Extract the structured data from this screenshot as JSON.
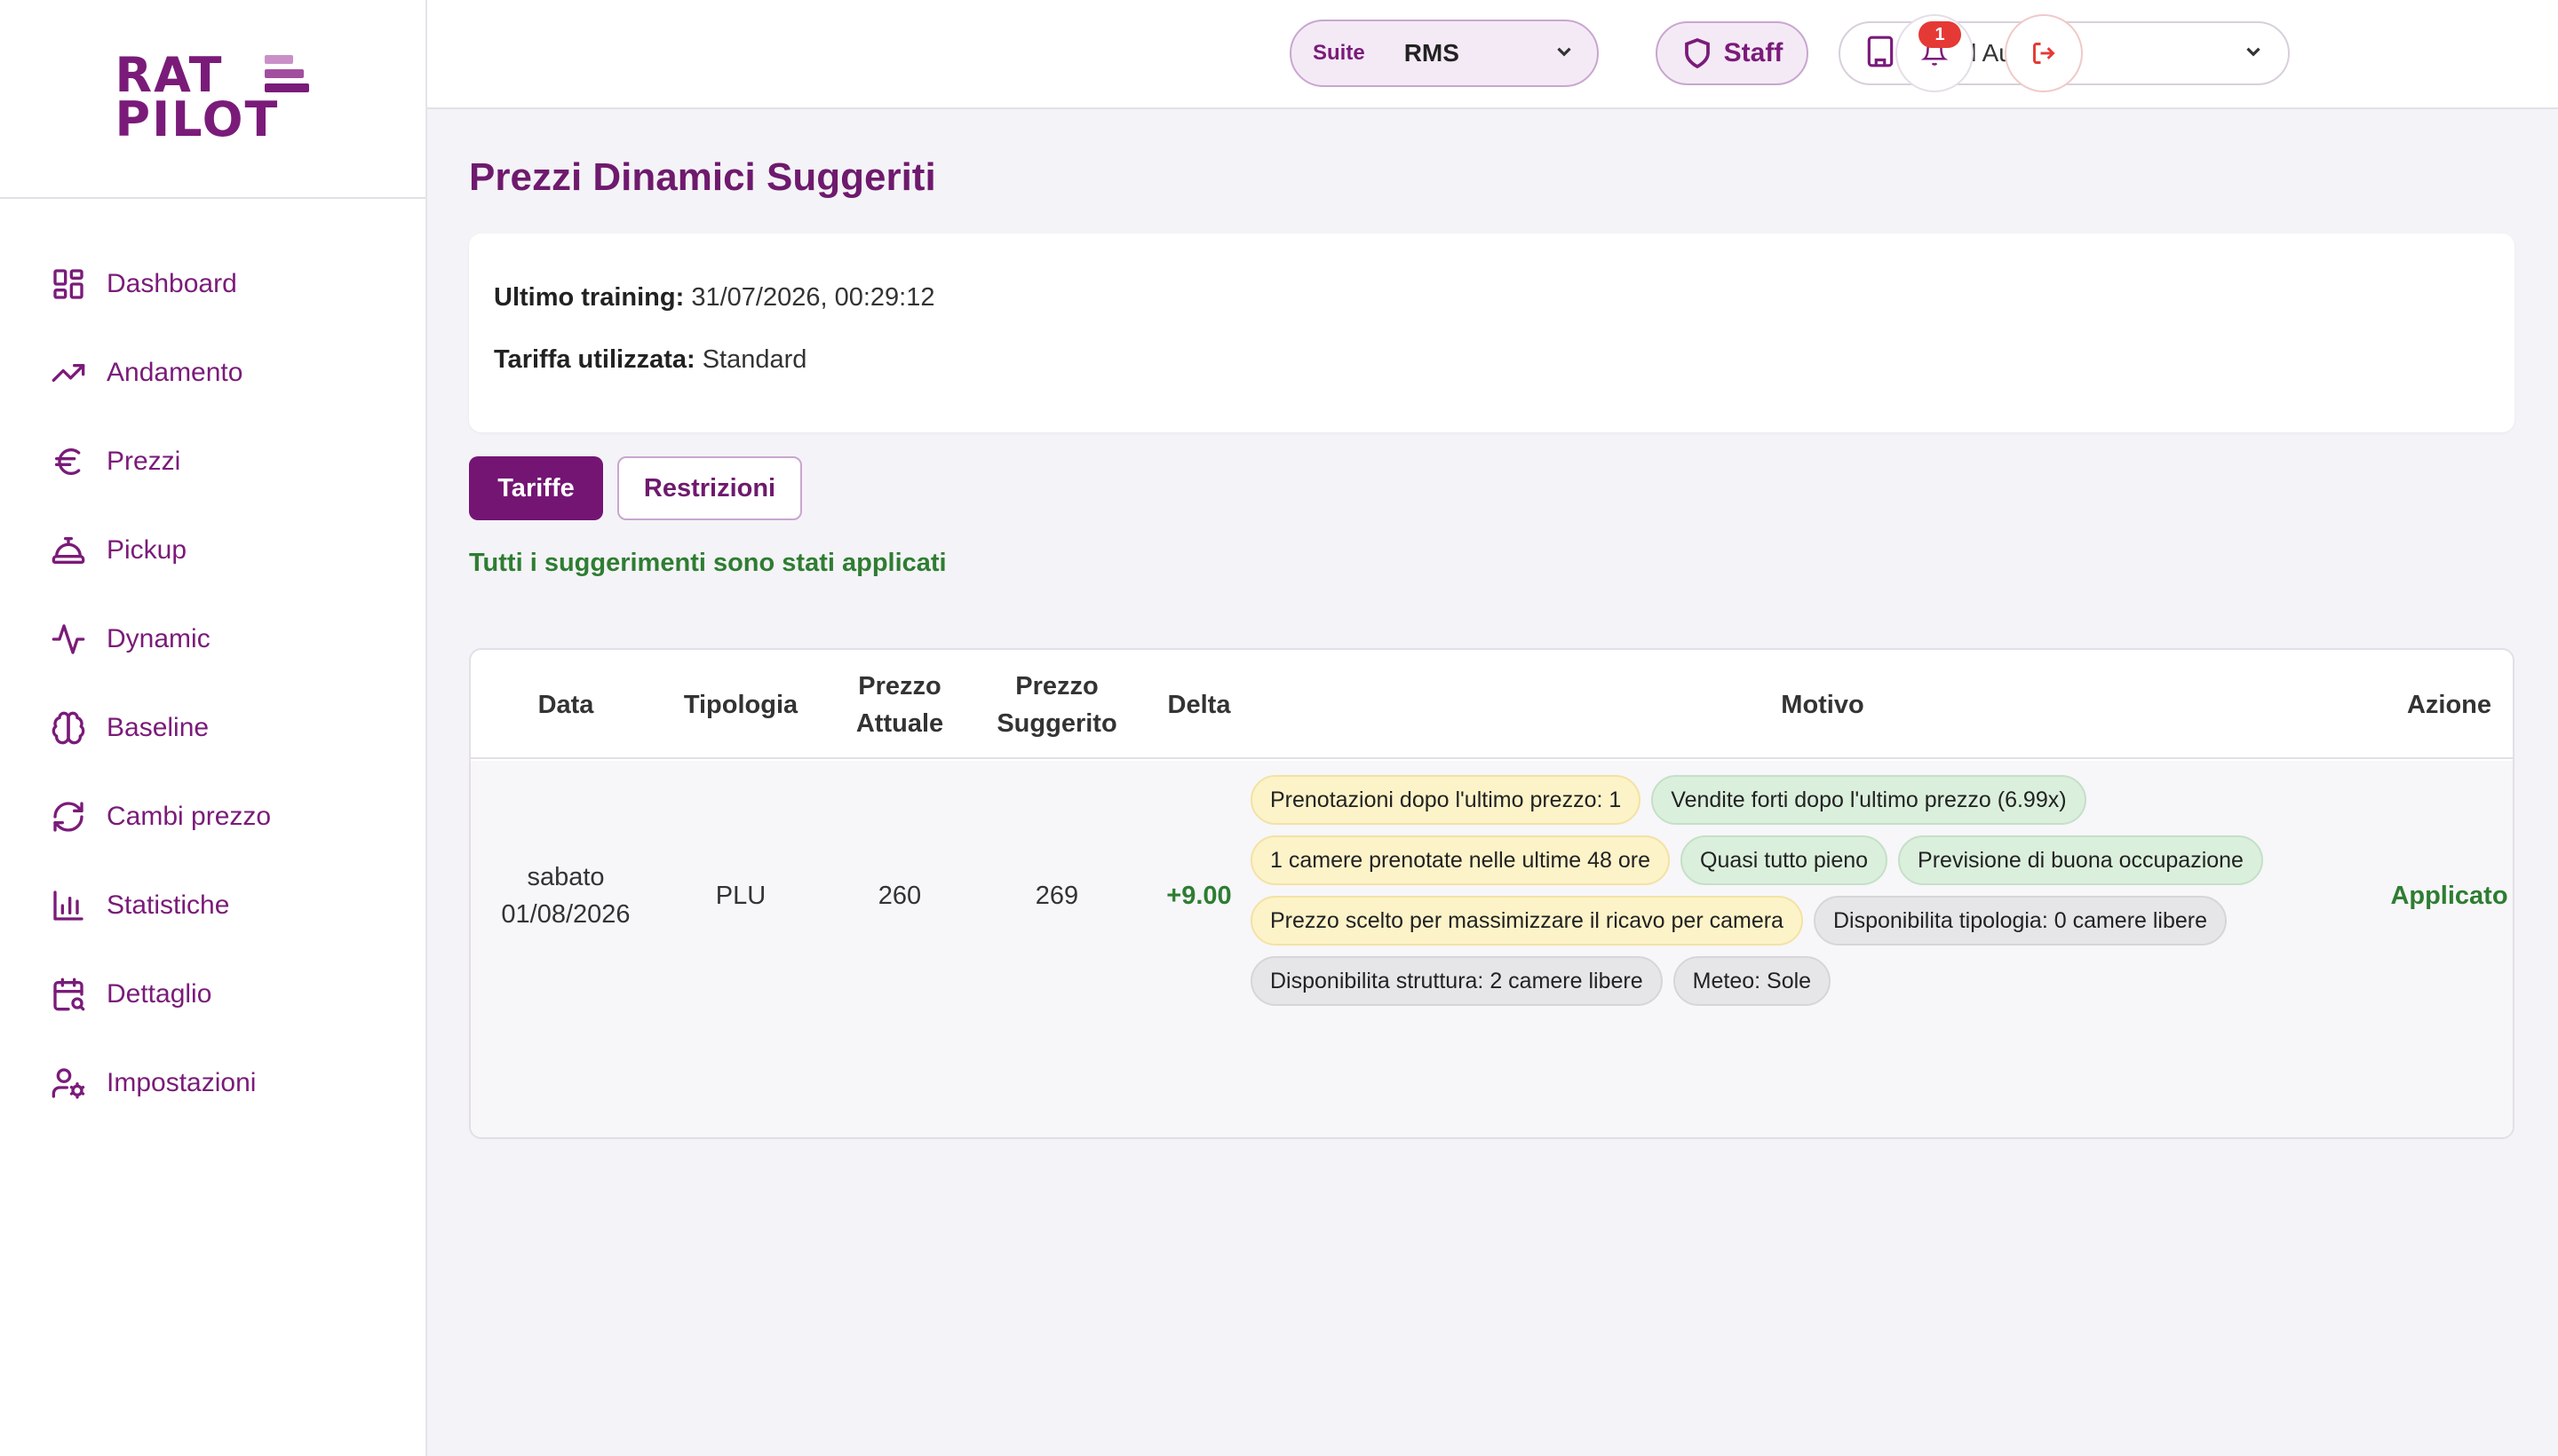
{
  "brand": {
    "line1": "RAT",
    "line2": "PILOT"
  },
  "sidebar": {
    "items": [
      {
        "label": "Dashboard",
        "icon": "dashboard-icon"
      },
      {
        "label": "Andamento",
        "icon": "trending-up-icon"
      },
      {
        "label": "Prezzi",
        "icon": "euro-icon"
      },
      {
        "label": "Pickup",
        "icon": "concierge-bell-icon"
      },
      {
        "label": "Dynamic",
        "icon": "activity-icon"
      },
      {
        "label": "Baseline",
        "icon": "brain-icon"
      },
      {
        "label": "Cambi prezzo",
        "icon": "refresh-icon"
      },
      {
        "label": "Statistiche",
        "icon": "bar-chart-icon"
      },
      {
        "label": "Dettaglio",
        "icon": "calendar-search-icon"
      },
      {
        "label": "Impostazioni",
        "icon": "user-cog-icon"
      }
    ]
  },
  "header": {
    "suite_label": "Suite",
    "suite_value": "RMS",
    "staff_label": "Staff",
    "hotel_value": "Hotel Aurora",
    "notifications_count": "1"
  },
  "main": {
    "title": "Prezzi Dinamici Suggeriti",
    "info": {
      "training_label": "Ultimo training:",
      "training_value": "31/07/2026, 00:29:12",
      "rate_label": "Tariffa utilizzata:",
      "rate_value": "Standard"
    },
    "tabs": [
      {
        "label": "Tariffe",
        "active": true
      },
      {
        "label": "Restrizioni",
        "active": false
      }
    ],
    "success_message": "Tutti i suggerimenti sono stati applicati",
    "table": {
      "headers": {
        "date": "Data",
        "type": "Tipologia",
        "current_l1": "Prezzo",
        "current_l2": "Attuale",
        "suggested_l1": "Prezzo",
        "suggested_l2": "Suggerito",
        "delta": "Delta",
        "reason": "Motivo",
        "action": "Azione"
      },
      "rows": [
        {
          "day": "sabato",
          "date": "01/08/2026",
          "type": "PLU",
          "current": "260",
          "suggested": "269",
          "delta": "+9.00",
          "action": "Applicato",
          "reasons": [
            {
              "text": "Prenotazioni dopo l'ultimo prezzo: 1",
              "tone": "yellow"
            },
            {
              "text": "Vendite forti dopo l'ultimo prezzo (6.99x)",
              "tone": "green"
            },
            {
              "text": "1 camere prenotate nelle ultime 48 ore",
              "tone": "yellow"
            },
            {
              "text": "Quasi tutto pieno",
              "tone": "green"
            },
            {
              "text": "Previsione di buona occupazione",
              "tone": "green"
            },
            {
              "text": "Prezzo scelto per massimizzare il ricavo per camera",
              "tone": "yellow"
            },
            {
              "text": "Disponibilita tipologia: 0 camere libere",
              "tone": "gray"
            },
            {
              "text": "Disponibilita struttura: 2 camere libere",
              "tone": "gray"
            },
            {
              "text": "Meteo: Sole",
              "tone": "gray"
            }
          ]
        }
      ]
    }
  },
  "colors": {
    "brand": "#7a1b79",
    "brand_dark": "#741573",
    "success": "#2e7d32",
    "danger": "#e53935",
    "chip_yellow": "#fdf3c9",
    "chip_green": "#dbefdd",
    "chip_gray": "#e6e6e8"
  }
}
